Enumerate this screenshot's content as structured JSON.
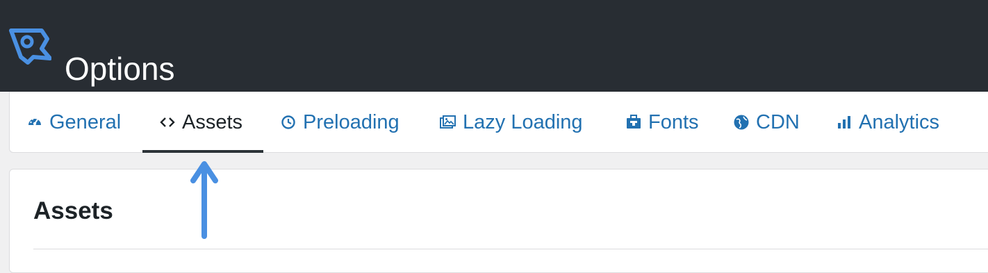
{
  "header": {
    "title": "Options",
    "logo_icon": "perfmatters-logo-icon",
    "background": "#282d33"
  },
  "tabs": [
    {
      "label": "General",
      "icon": "dashboard-icon",
      "active": false
    },
    {
      "label": "Assets",
      "icon": "code-icon",
      "active": true
    },
    {
      "label": "Preloading",
      "icon": "clock-icon",
      "active": false
    },
    {
      "label": "Lazy Loading",
      "icon": "images-icon",
      "active": false
    },
    {
      "label": "Fonts",
      "icon": "font-box-icon",
      "active": false
    },
    {
      "label": "CDN",
      "icon": "globe-icon",
      "active": false
    },
    {
      "label": "Analytics",
      "icon": "bar-chart-icon",
      "active": false
    }
  ],
  "main": {
    "section_title": "Assets"
  },
  "annotation": {
    "arrow_icon": "arrow-up-icon",
    "color": "#4a90e2"
  },
  "colors": {
    "accent": "#2271b1",
    "active_tab": "#1d2327",
    "logo": "#4a90e2"
  }
}
